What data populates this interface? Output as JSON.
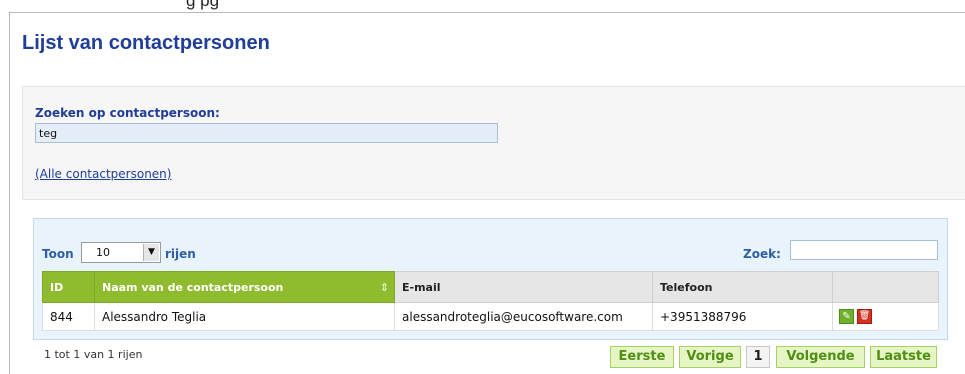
{
  "top_caption": "g      pg",
  "page_title": "Lijst van contactpersonen",
  "search": {
    "label": "Zoeken op contactpersoon:",
    "value": "teg",
    "all_link": "(Alle contactpersonen)"
  },
  "table_controls": {
    "show_label": "Toon",
    "rows_per_page": "10",
    "rows_label": "rijen",
    "search_label": "Zoek:",
    "search_value": ""
  },
  "table": {
    "columns": [
      "ID",
      "Naam van de contactpersoon",
      "E-mail",
      "Telefoon",
      ""
    ],
    "rows": [
      {
        "id": "844",
        "name": "Alessandro Teglia",
        "email": "alessandroteglia@eucosoftware.com",
        "phone": "+3951388796"
      }
    ]
  },
  "info": "1 tot 1 van 1 rijen",
  "pagination": {
    "first": "Eerste",
    "prev": "Vorige",
    "page": "1",
    "next": "Volgende",
    "last": "Laatste"
  },
  "colors": {
    "title": "#1f3d99",
    "header_green": "#8fbc2f",
    "pager_green": "#4e8f14"
  },
  "icons": [
    "edit-icon",
    "delete-icon",
    "sort-icon",
    "dropdown-arrow-icon"
  ]
}
